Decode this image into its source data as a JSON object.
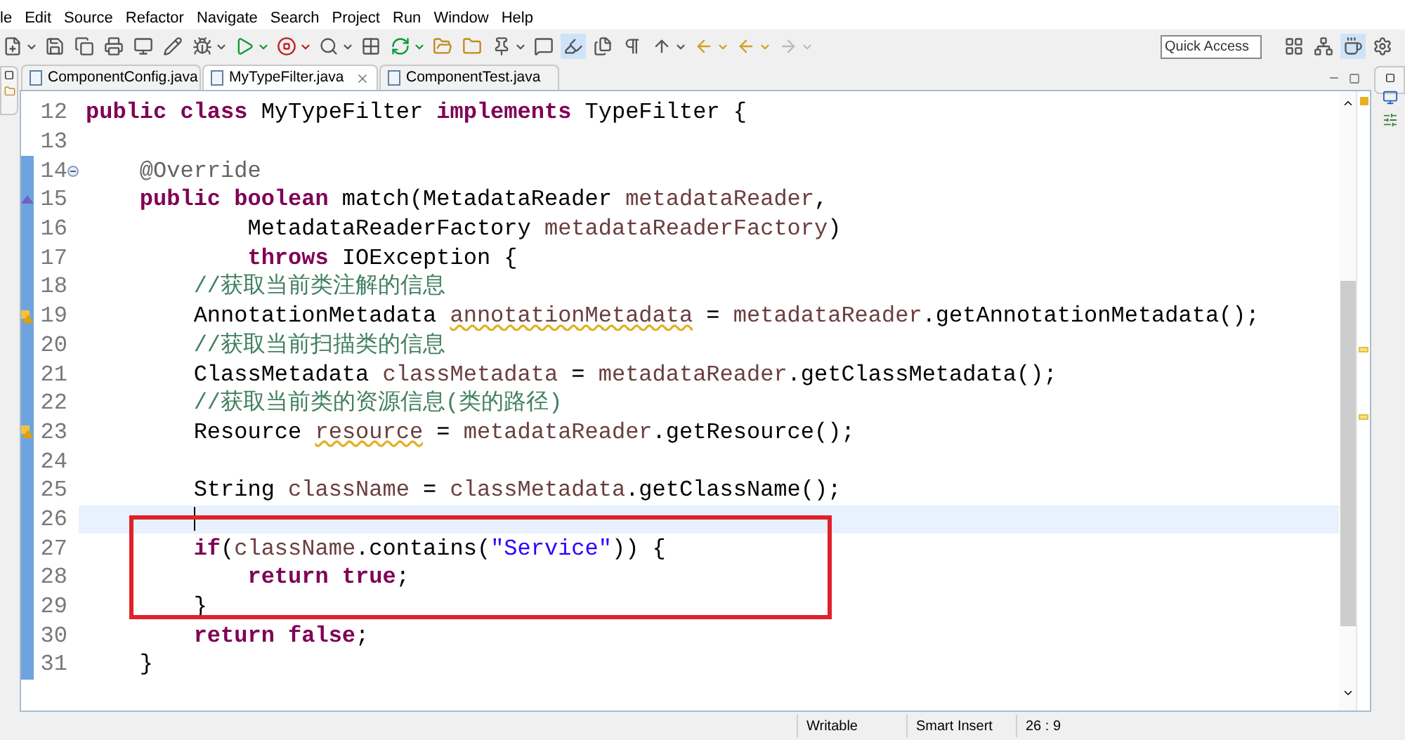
{
  "menu": [
    "le",
    "Edit",
    "Source",
    "Refactor",
    "Navigate",
    "Search",
    "Project",
    "Run",
    "Window",
    "Help"
  ],
  "quick_access": {
    "placeholder": "Quick Access"
  },
  "tabs": [
    {
      "label": "ComponentConfig.java",
      "selected": false
    },
    {
      "label": "MyTypeFilter.java",
      "selected": true
    },
    {
      "label": "ComponentTest.java",
      "selected": false
    }
  ],
  "editor": {
    "lines": [
      {
        "number": "12",
        "kind": "code",
        "range_marked": false,
        "current": false,
        "boxed": false,
        "tokens": [
          {
            "kind": "keyword",
            "text": "public"
          },
          {
            "kind": "keyword",
            "text": " class"
          },
          {
            "kind": "plain",
            "text": " MyTypeFilter"
          },
          {
            "kind": "keyword",
            "text": " implements"
          },
          {
            "kind": "plain",
            "text": " TypeFilter {"
          }
        ]
      },
      {
        "number": "13",
        "kind": "code",
        "range_marked": false,
        "current": false,
        "boxed": false
      },
      {
        "number": "14",
        "kind": "fold",
        "range_marked": true,
        "current": false,
        "boxed": false,
        "tokens": [
          {
            "kind": "annotation",
            "text": "    @Override"
          }
        ]
      },
      {
        "number": "15",
        "kind": "override",
        "range_marked": true,
        "current": false,
        "boxed": false,
        "tokens": [
          {
            "kind": "keyword",
            "text": "    public"
          },
          {
            "kind": "keyword",
            "text": " boolean"
          },
          {
            "kind": "plain",
            "text": " match(MetadataReader"
          },
          {
            "kind": "param",
            "text": " metadataReader"
          },
          {
            "kind": "plain",
            "text": ","
          }
        ]
      },
      {
        "number": "16",
        "kind": "code",
        "range_marked": true,
        "current": false,
        "boxed": false,
        "tokens": [
          {
            "kind": "plain",
            "text": "            MetadataReaderFactory"
          },
          {
            "kind": "param",
            "text": " metadataReaderFactory"
          },
          {
            "kind": "plain",
            "text": ")"
          }
        ]
      },
      {
        "number": "17",
        "kind": "code",
        "range_marked": true,
        "current": false,
        "boxed": false,
        "tokens": [
          {
            "kind": "keyword",
            "text": "            throws"
          },
          {
            "kind": "plain",
            "text": " IOException {"
          }
        ]
      },
      {
        "number": "18",
        "kind": "code",
        "range_marked": true,
        "current": false,
        "boxed": false,
        "tokens": [
          {
            "kind": "comment",
            "text": "        //获取当前类注解的信息"
          }
        ]
      },
      {
        "number": "19",
        "kind": "warning",
        "range_marked": true,
        "current": false,
        "boxed": false,
        "tokens": [
          {
            "kind": "plain",
            "text": "        AnnotationMetadata "
          },
          {
            "kind": "warn",
            "text": "annotationMetadata"
          },
          {
            "kind": "plain",
            "text": " ="
          },
          {
            "kind": "param",
            "text": " metadataReader"
          },
          {
            "kind": "plain",
            "text": ".getAnnotationMetadata();"
          }
        ]
      },
      {
        "number": "20",
        "kind": "code",
        "range_marked": true,
        "current": false,
        "boxed": false,
        "tokens": [
          {
            "kind": "comment",
            "text": "        //获取当前扫描类的信息"
          }
        ]
      },
      {
        "number": "21",
        "kind": "code",
        "range_marked": true,
        "current": false,
        "boxed": false,
        "tokens": [
          {
            "kind": "plain",
            "text": "        ClassMetadata"
          },
          {
            "kind": "local",
            "text": " classMetadata"
          },
          {
            "kind": "plain",
            "text": " ="
          },
          {
            "kind": "param",
            "text": " metadataReader"
          },
          {
            "kind": "plain",
            "text": ".getClassMetadata();"
          }
        ]
      },
      {
        "number": "22",
        "kind": "code",
        "range_marked": true,
        "current": false,
        "boxed": false,
        "tokens": [
          {
            "kind": "comment",
            "text": "        //获取当前类的资源信息(类的路径)"
          }
        ]
      },
      {
        "number": "23",
        "kind": "warning",
        "range_marked": true,
        "current": false,
        "boxed": false,
        "tokens": [
          {
            "kind": "plain",
            "text": "        Resource "
          },
          {
            "kind": "warn",
            "text": "resource"
          },
          {
            "kind": "plain",
            "text": " ="
          },
          {
            "kind": "param",
            "text": " metadataReader"
          },
          {
            "kind": "plain",
            "text": ".getResource();"
          }
        ]
      },
      {
        "number": "24",
        "kind": "code",
        "range_marked": true,
        "current": false,
        "boxed": false
      },
      {
        "number": "25",
        "kind": "code",
        "range_marked": true,
        "current": false,
        "boxed": false,
        "tokens": [
          {
            "kind": "plain",
            "text": "        String"
          },
          {
            "kind": "local",
            "text": " className"
          },
          {
            "kind": "plain",
            "text": " ="
          },
          {
            "kind": "local",
            "text": " classMetadata"
          },
          {
            "kind": "plain",
            "text": ".getClassName();"
          }
        ]
      },
      {
        "number": "26",
        "kind": "code",
        "range_marked": true,
        "current": true,
        "boxed": false
      },
      {
        "number": "27",
        "kind": "code",
        "range_marked": true,
        "current": false,
        "boxed": true,
        "tokens": [
          {
            "kind": "keyword",
            "text": "        if"
          },
          {
            "kind": "plain",
            "text": "("
          },
          {
            "kind": "local",
            "text": "className"
          },
          {
            "kind": "plain",
            "text": ".contains("
          },
          {
            "kind": "string",
            "text": "\"Service\""
          },
          {
            "kind": "plain",
            "text": ")) {"
          }
        ]
      },
      {
        "number": "28",
        "kind": "code",
        "range_marked": true,
        "current": false,
        "boxed": true,
        "tokens": [
          {
            "kind": "keyword",
            "text": "            return"
          },
          {
            "kind": "keyword",
            "text": " true"
          },
          {
            "kind": "plain",
            "text": ";"
          }
        ]
      },
      {
        "number": "29",
        "kind": "code",
        "range_marked": true,
        "current": false,
        "boxed": true,
        "tokens": [
          {
            "kind": "plain",
            "text": "        }"
          }
        ]
      },
      {
        "number": "30",
        "kind": "code",
        "range_marked": true,
        "current": false,
        "boxed": false,
        "tokens": [
          {
            "kind": "keyword",
            "text": "        return"
          },
          {
            "kind": "keyword",
            "text": " false"
          },
          {
            "kind": "plain",
            "text": ";"
          }
        ]
      },
      {
        "number": "31",
        "kind": "code",
        "range_marked": true,
        "current": false,
        "boxed": false,
        "tokens": [
          {
            "kind": "plain",
            "text": "    }"
          }
        ]
      }
    ]
  },
  "status_bar": [
    "Writable",
    "Smart Insert",
    "26 : 9"
  ]
}
